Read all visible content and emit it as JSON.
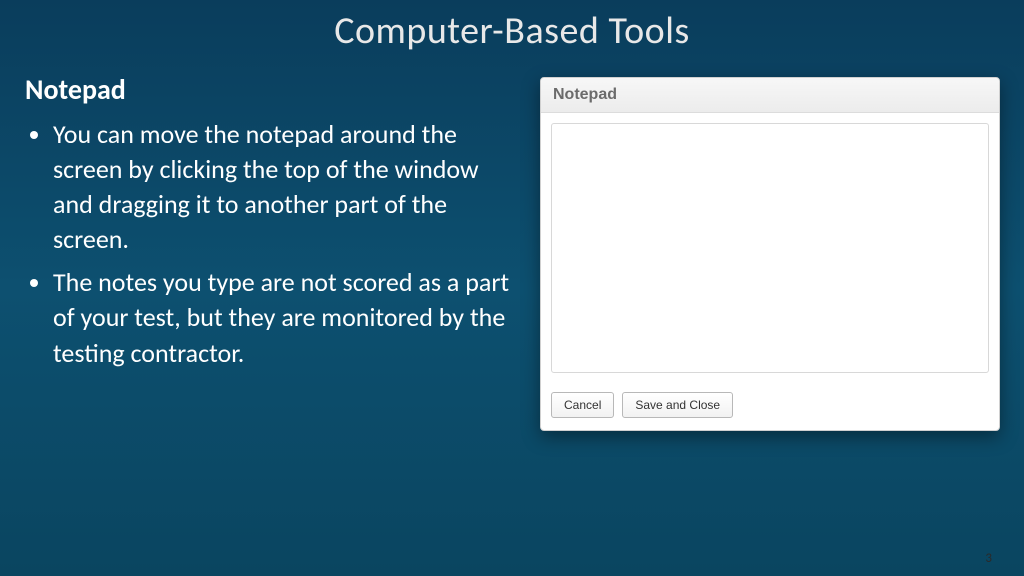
{
  "slide": {
    "title": "Computer-Based Tools",
    "section_heading": "Notepad",
    "bullets": [
      "You can move the notepad around the screen by clicking the top of the window and dragging it to another part of the screen.",
      "The notes you type are not scored as a part of your test, but they are monitored by the testing contractor."
    ],
    "page_number": "3"
  },
  "notepad": {
    "title": "Notepad",
    "textarea_value": "",
    "cancel_label": "Cancel",
    "save_label": "Save and Close"
  }
}
